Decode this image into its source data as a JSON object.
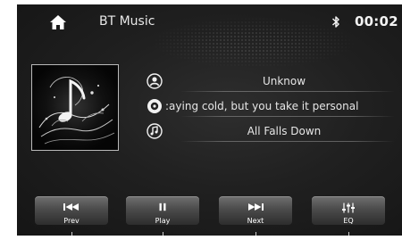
{
  "header": {
    "title": "BT Music",
    "clock": "00:02",
    "home_icon": "home-icon",
    "status_icon": "bluetooth-icon"
  },
  "track": {
    "artist": "Unknow",
    "album": ":aying cold, but you take it personal",
    "title": "All Falls Down",
    "artist_icon": "artist-icon",
    "album_icon": "album-disc-icon",
    "title_icon": "music-note-icon"
  },
  "controls": {
    "prev": "Prev",
    "play": "Play",
    "next": "Next",
    "eq": "EQ"
  },
  "colors": {
    "background": "#1f1f1f",
    "text": "#f2f2f2",
    "button_top": "#707070",
    "button_bottom": "#2d2d2d"
  }
}
